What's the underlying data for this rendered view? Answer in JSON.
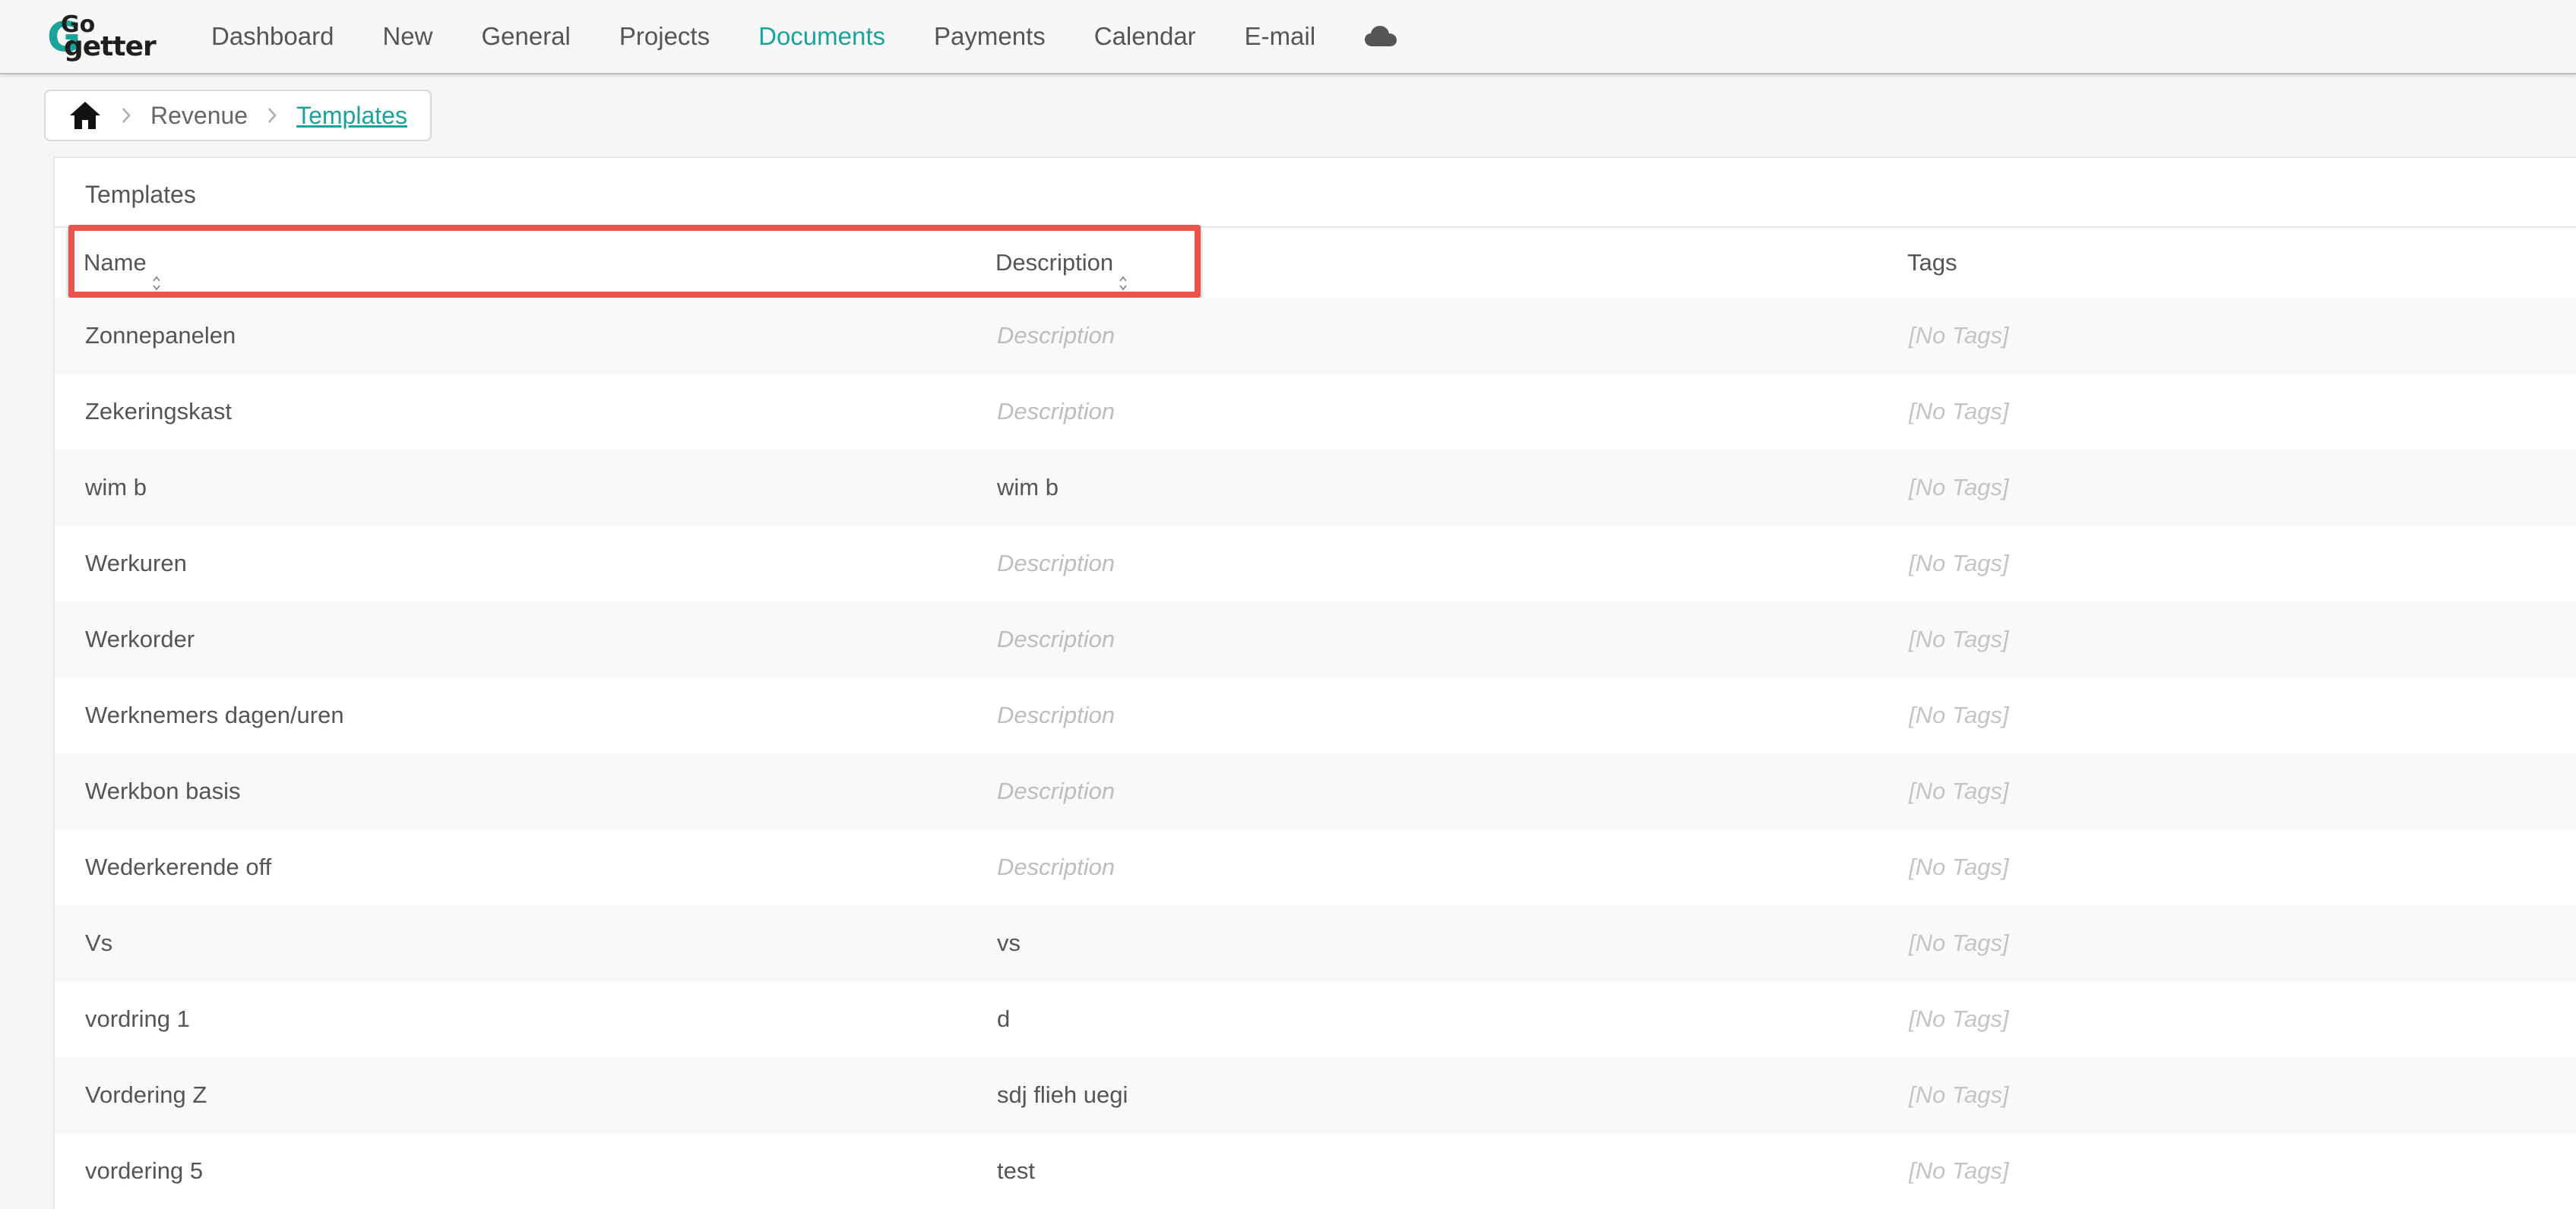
{
  "logo": {
    "g": "G",
    "go": "Go",
    "getter": "getter"
  },
  "nav": {
    "items": [
      {
        "label": "Dashboard",
        "active": false
      },
      {
        "label": "New",
        "active": false
      },
      {
        "label": "General",
        "active": false
      },
      {
        "label": "Projects",
        "active": false
      },
      {
        "label": "Documents",
        "active": true
      },
      {
        "label": "Payments",
        "active": false
      },
      {
        "label": "Calendar",
        "active": false
      },
      {
        "label": "E-mail",
        "active": false
      }
    ],
    "cloud_icon": "cloud-icon"
  },
  "breadcrumb": {
    "home_icon": "home-icon",
    "items": [
      "Revenue",
      "Templates"
    ]
  },
  "panel": {
    "title": "Templates"
  },
  "table": {
    "columns": {
      "name": "Name",
      "description": "Description",
      "tags": "Tags"
    },
    "rows": [
      {
        "name": "Zonnepanelen",
        "description": "Description",
        "description_placeholder": true,
        "tags": "[No Tags]"
      },
      {
        "name": "Zekeringskast",
        "description": "Description",
        "description_placeholder": true,
        "tags": "[No Tags]"
      },
      {
        "name": "wim b",
        "description": "wim b",
        "description_placeholder": false,
        "tags": "[No Tags]"
      },
      {
        "name": "Werkuren",
        "description": "Description",
        "description_placeholder": true,
        "tags": "[No Tags]"
      },
      {
        "name": "Werkorder",
        "description": "Description",
        "description_placeholder": true,
        "tags": "[No Tags]"
      },
      {
        "name": "Werknemers dagen/uren",
        "description": "Description",
        "description_placeholder": true,
        "tags": "[No Tags]"
      },
      {
        "name": "Werkbon basis",
        "description": "Description",
        "description_placeholder": true,
        "tags": "[No Tags]"
      },
      {
        "name": "Wederkerende off",
        "description": "Description",
        "description_placeholder": true,
        "tags": "[No Tags]"
      },
      {
        "name": "Vs",
        "description": "vs",
        "description_placeholder": false,
        "tags": "[No Tags]"
      },
      {
        "name": "vordring 1",
        "description": "d",
        "description_placeholder": false,
        "tags": "[No Tags]"
      },
      {
        "name": "Vordering Z",
        "description": "sdj flieh uegi",
        "description_placeholder": false,
        "tags": "[No Tags]"
      },
      {
        "name": "vordering 5",
        "description": "test",
        "description_placeholder": false,
        "tags": "[No Tags]"
      }
    ]
  },
  "colors": {
    "accent": "#1aa39a",
    "highlight": "#e8544b"
  }
}
